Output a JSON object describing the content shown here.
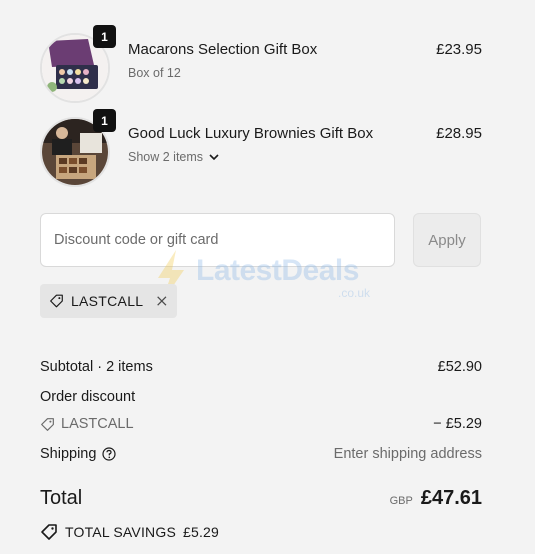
{
  "cart": {
    "items": [
      {
        "quantity": "1",
        "name": "Macarons Selection Gift Box",
        "subtitle": "Box of 12",
        "price": "£23.95"
      },
      {
        "quantity": "1",
        "name": "Good Luck Luxury Brownies Gift Box",
        "subtitle": "Show 2 items",
        "price": "£28.95"
      }
    ]
  },
  "discount": {
    "placeholder": "Discount code or gift card",
    "apply_label": "Apply",
    "applied_code": "LASTCALL"
  },
  "watermark": {
    "text": "LatestDeals",
    "sub": ".co.uk"
  },
  "summary": {
    "subtotal_label": "Subtotal · 2 items",
    "subtotal_value": "£52.90",
    "order_discount_label": "Order discount",
    "discount_code": "LASTCALL",
    "discount_value": "− £5.29",
    "shipping_label": "Shipping",
    "shipping_value": "Enter shipping address",
    "total_label": "Total",
    "currency": "GBP",
    "total_value": "£47.61",
    "savings_label": "TOTAL SAVINGS",
    "savings_value": "£5.29"
  },
  "colors": {
    "background": "#f3f3f3",
    "badge": "#111111",
    "muted_text": "#6b6b6b",
    "chip_bg": "#e5e5e5"
  }
}
